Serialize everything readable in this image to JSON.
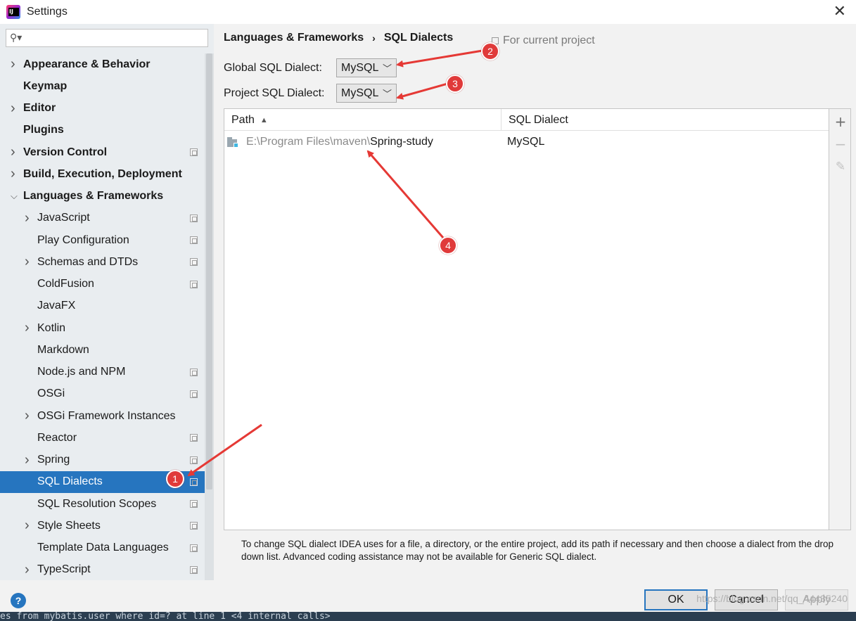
{
  "window": {
    "title": "Settings"
  },
  "search": {
    "placeholder": "",
    "value": ""
  },
  "tree": [
    {
      "label": "Appearance & Behavior",
      "level": 0,
      "expander": "collapsed",
      "project": false,
      "selected": false
    },
    {
      "label": "Keymap",
      "level": 0,
      "expander": "none",
      "project": false,
      "selected": false
    },
    {
      "label": "Editor",
      "level": 0,
      "expander": "collapsed",
      "project": false,
      "selected": false
    },
    {
      "label": "Plugins",
      "level": 0,
      "expander": "none",
      "project": false,
      "selected": false
    },
    {
      "label": "Version Control",
      "level": 0,
      "expander": "collapsed",
      "project": true,
      "selected": false
    },
    {
      "label": "Build, Execution, Deployment",
      "level": 0,
      "expander": "collapsed",
      "project": false,
      "selected": false
    },
    {
      "label": "Languages & Frameworks",
      "level": 0,
      "expander": "expanded",
      "project": false,
      "selected": false
    },
    {
      "label": "JavaScript",
      "level": 1,
      "expander": "collapsed",
      "project": true,
      "selected": false
    },
    {
      "label": "Play Configuration",
      "level": 1,
      "expander": "none",
      "project": true,
      "selected": false
    },
    {
      "label": "Schemas and DTDs",
      "level": 1,
      "expander": "collapsed",
      "project": true,
      "selected": false
    },
    {
      "label": "ColdFusion",
      "level": 1,
      "expander": "none",
      "project": true,
      "selected": false
    },
    {
      "label": "JavaFX",
      "level": 1,
      "expander": "none",
      "project": false,
      "selected": false
    },
    {
      "label": "Kotlin",
      "level": 1,
      "expander": "collapsed",
      "project": false,
      "selected": false
    },
    {
      "label": "Markdown",
      "level": 1,
      "expander": "none",
      "project": false,
      "selected": false
    },
    {
      "label": "Node.js and NPM",
      "level": 1,
      "expander": "none",
      "project": true,
      "selected": false
    },
    {
      "label": "OSGi",
      "level": 1,
      "expander": "none",
      "project": true,
      "selected": false
    },
    {
      "label": "OSGi Framework Instances",
      "level": 1,
      "expander": "collapsed",
      "project": false,
      "selected": false
    },
    {
      "label": "Reactor",
      "level": 1,
      "expander": "none",
      "project": true,
      "selected": false
    },
    {
      "label": "Spring",
      "level": 1,
      "expander": "collapsed",
      "project": true,
      "selected": false
    },
    {
      "label": "SQL Dialects",
      "level": 1,
      "expander": "none",
      "project": true,
      "selected": true
    },
    {
      "label": "SQL Resolution Scopes",
      "level": 1,
      "expander": "none",
      "project": true,
      "selected": false
    },
    {
      "label": "Style Sheets",
      "level": 1,
      "expander": "collapsed",
      "project": true,
      "selected": false
    },
    {
      "label": "Template Data Languages",
      "level": 1,
      "expander": "none",
      "project": true,
      "selected": false
    },
    {
      "label": "TypeScript",
      "level": 1,
      "expander": "collapsed",
      "project": true,
      "selected": false
    }
  ],
  "breadcrumb": {
    "parent": "Languages & Frameworks",
    "separator": "›",
    "current": "SQL Dialects"
  },
  "for_project": "For current project",
  "global_dialect": {
    "label": "Global SQL Dialect:",
    "value": "MySQL"
  },
  "project_dialect": {
    "label": "Project SQL Dialect:",
    "value": "MySQL"
  },
  "table": {
    "columns": {
      "path": "Path",
      "dialect": "SQL Dialect"
    },
    "rows": [
      {
        "path_prefix": "E:\\Program Files\\maven\\",
        "path_name": "Spring-study",
        "dialect": "MySQL"
      }
    ]
  },
  "tools": {
    "add": "+",
    "remove": "−",
    "edit": "✎"
  },
  "help_text": "To change SQL dialect IDEA uses for a file, a directory, or the entire project, add its path if necessary and then choose a dialect from the drop down list. Advanced coding assistance may not be available for Generic SQL dialect.",
  "buttons": {
    "help": "?",
    "ok": "OK",
    "cancel": "Cancel",
    "apply": "Apply"
  },
  "console_text": "es from mybatis.user where id=? at line 1 <4 internal calls>",
  "watermark": "https://blog.csdn.net/qq_44435240",
  "annotations": [
    "1",
    "2",
    "3",
    "4"
  ],
  "colors": {
    "selection": "#2675bf",
    "annotation": "#e03a3a",
    "sidebar": "#e9edf0"
  }
}
